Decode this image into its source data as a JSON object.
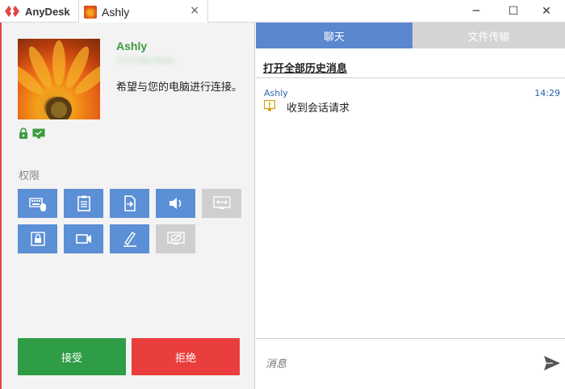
{
  "titlebar": {
    "brand": "AnyDesk",
    "tab_title": "Ashly",
    "tab_close": "×",
    "win_min": "─",
    "win_max": "☐",
    "win_close": "✕"
  },
  "caller": {
    "name": "Ashly",
    "id": "(737282369)",
    "request": "希望与您的电脑进行连接。"
  },
  "permissions": {
    "label": "权限",
    "buttons": [
      {
        "icon": "keyboard-mouse-icon",
        "enabled": true
      },
      {
        "icon": "clipboard-icon",
        "enabled": true
      },
      {
        "icon": "file-transfer-icon",
        "enabled": true
      },
      {
        "icon": "sound-icon",
        "enabled": true
      },
      {
        "icon": "control-screen-icon",
        "enabled": false
      },
      {
        "icon": "lock-icon",
        "enabled": true
      },
      {
        "icon": "record-icon",
        "enabled": true
      },
      {
        "icon": "draw-icon",
        "enabled": true
      },
      {
        "icon": "privacy-icon",
        "enabled": false
      }
    ]
  },
  "actions": {
    "accept": "接受",
    "decline": "拒绝"
  },
  "chat": {
    "tab_chat": "聊天",
    "tab_files": "文件传输",
    "history_link": "打开全部历史消息",
    "messages": [
      {
        "sender": "Ashly",
        "time": "14:29",
        "text": "收到会话请求"
      }
    ],
    "input_placeholder": "消息"
  },
  "colors": {
    "brand_red": "#e04848",
    "perm_blue": "#5b8fd6",
    "accept_green": "#2f9c46",
    "decline_red": "#ea3d3d",
    "chat_tab_blue": "#5b87cf"
  }
}
